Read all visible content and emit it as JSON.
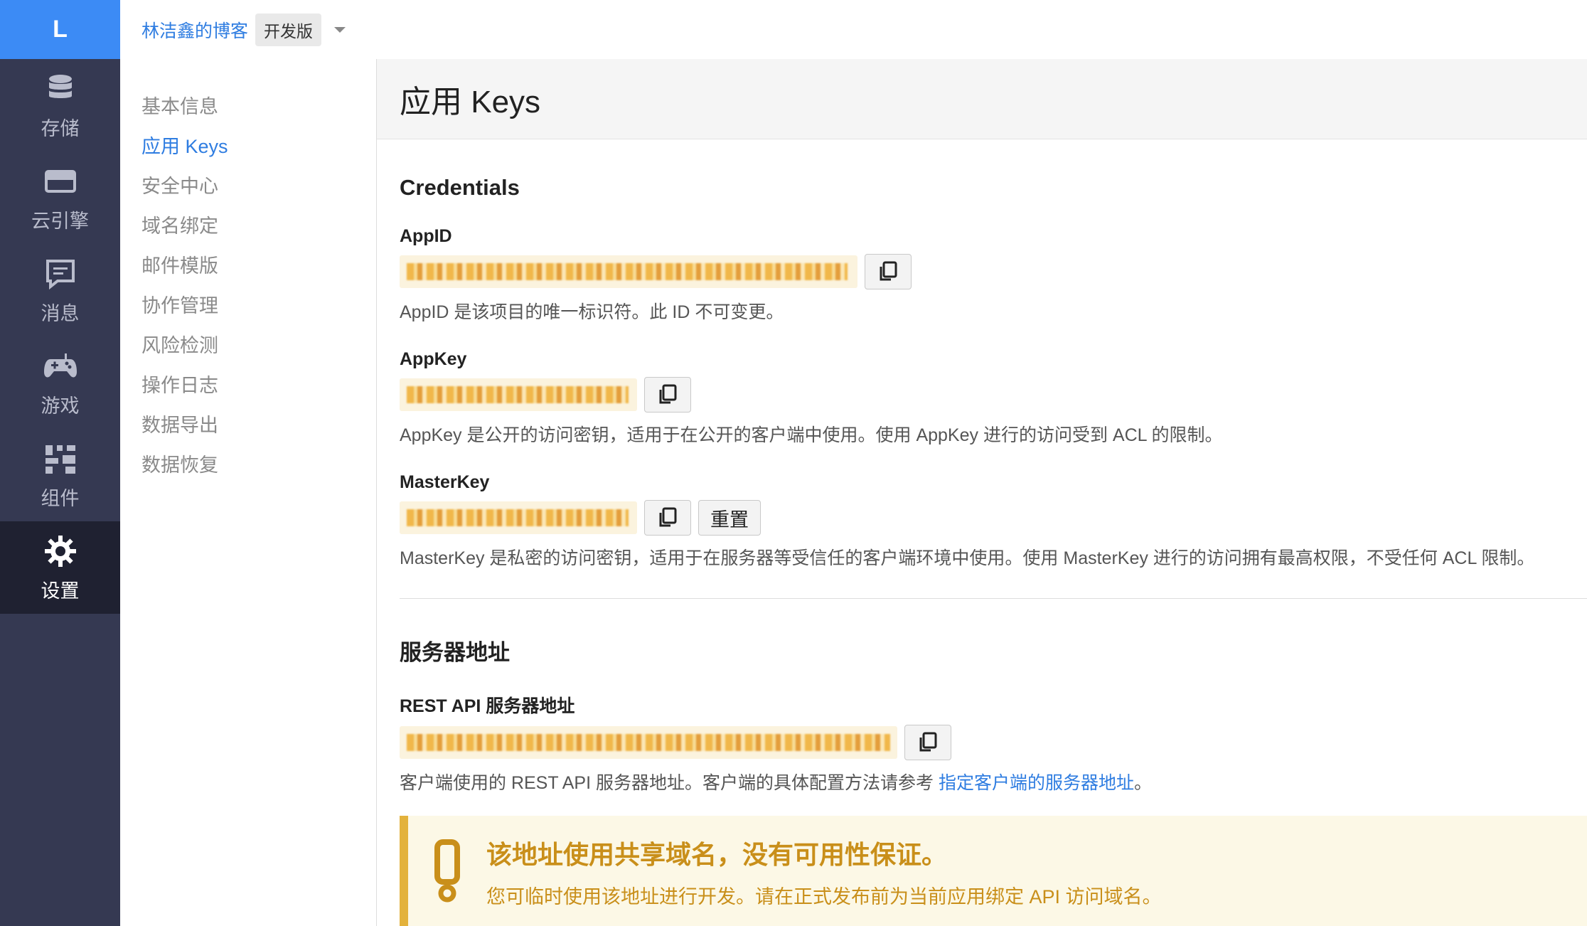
{
  "rail": {
    "logo": "L",
    "items": [
      {
        "label": "存储",
        "icon": "database-icon"
      },
      {
        "label": "云引擎",
        "icon": "server-icon"
      },
      {
        "label": "消息",
        "icon": "message-icon"
      },
      {
        "label": "游戏",
        "icon": "gamepad-icon"
      },
      {
        "label": "组件",
        "icon": "components-icon"
      },
      {
        "label": "设置",
        "icon": "gear-icon",
        "active": true
      }
    ]
  },
  "topbar": {
    "app_name": "林洁鑫的博客",
    "env_badge": "开发版"
  },
  "subnav": {
    "items": [
      "基本信息",
      "应用 Keys",
      "安全中心",
      "域名绑定",
      "邮件模版",
      "协作管理",
      "风险检测",
      "操作日志",
      "数据导出",
      "数据恢复"
    ],
    "active_index": 1
  },
  "page": {
    "title": "应用 Keys"
  },
  "credentials": {
    "section_title": "Credentials",
    "appid": {
      "label": "AppID",
      "help": "AppID 是该项目的唯一标识符。此 ID 不可变更。"
    },
    "appkey": {
      "label": "AppKey",
      "help": "AppKey 是公开的访问密钥，适用于在公开的客户端中使用。使用 AppKey 进行的访问受到 ACL 的限制。"
    },
    "masterkey": {
      "label": "MasterKey",
      "reset_label": "重置",
      "help": "MasterKey 是私密的访问密钥，适用于在服务器等受信任的客户端环境中使用。使用 MasterKey 进行的访问拥有最高权限，不受任何 ACL 限制。"
    }
  },
  "server": {
    "section_title": "服务器地址",
    "rest": {
      "label": "REST API 服务器地址",
      "help_prefix": "客户端使用的 REST API 服务器地址。客户端的具体配置方法请参考 ",
      "help_link": "指定客户端的服务器地址",
      "help_suffix": "。"
    },
    "alert": {
      "title": "该地址使用共享域名，没有可用性保证。",
      "text": "您可临时使用该地址进行开发。请在正式发布前为当前应用绑定 API 访问域名。"
    }
  },
  "colors": {
    "accent": "#2f7de1",
    "rail_bg": "#353952",
    "rail_active_bg": "#1f2131",
    "logo_bg": "#3c8bf5",
    "warning": "#c98f1a"
  }
}
